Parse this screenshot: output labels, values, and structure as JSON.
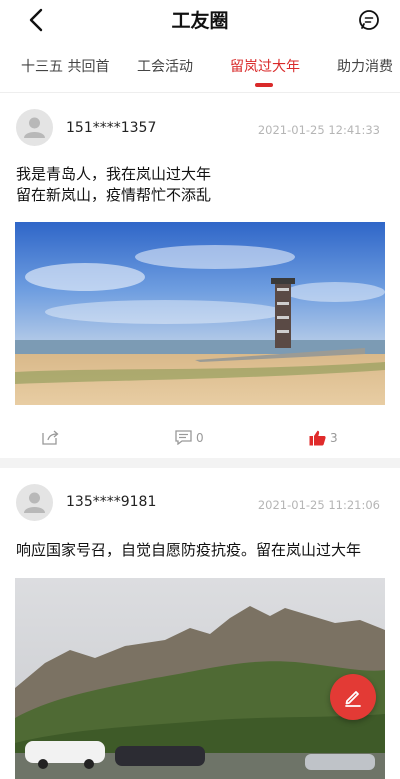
{
  "header": {
    "title": "工友圈"
  },
  "tabs": [
    {
      "label": "十三五 共回首",
      "active": false
    },
    {
      "label": "工会活动",
      "active": false
    },
    {
      "label": "留岚过大年",
      "active": true
    },
    {
      "label": "助力消费",
      "active": false
    }
  ],
  "posts": [
    {
      "username": "151****1357",
      "timestamp": "2021-01-25 12:41:33",
      "content_lines": [
        "我是青岛人，我在岚山过大年",
        "留在新岚山，疫情帮忙不添乱"
      ],
      "comment_count": "0",
      "like_count": "3"
    },
    {
      "username": "135****9181",
      "timestamp": "2021-01-25 11:21:06",
      "content_lines": [
        "响应国家号召，自觉自愿防疫抗疫。留在岚山过大年"
      ]
    }
  ],
  "colors": {
    "accent": "#d92a2a",
    "fab": "#e33a35"
  }
}
